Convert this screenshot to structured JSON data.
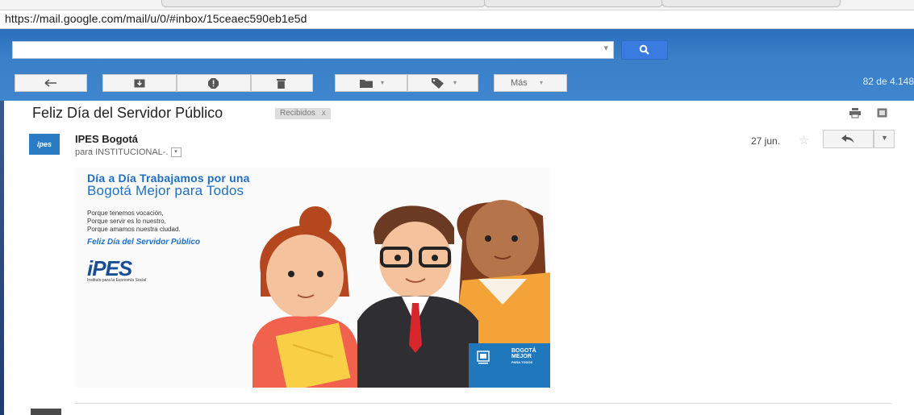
{
  "browser": {
    "url": "https://mail.google.com/mail/u/0/#inbox/15ceaec590eb1e5d"
  },
  "search": {
    "placeholder": ""
  },
  "toolbar": {
    "more_label": "Más",
    "counter": "82 de 4.148",
    "icons": [
      "back-arrow-icon",
      "archive-icon",
      "report-spam-icon",
      "trash-icon",
      "folder-icon",
      "label-icon"
    ]
  },
  "message": {
    "subject": "Feliz Día del Servidor Público",
    "label_chip": "Recibidos",
    "label_close": "x",
    "avatar_text": "ipes",
    "sender": "IPES Bogotá",
    "recipients": "para INSTITUCIONAL-.",
    "date": "27 jun.",
    "star": "☆"
  },
  "banner": {
    "title_line1": "Día a Día Trabajamos por una",
    "title_line2": "Bogotá Mejor para Todos",
    "lines": [
      "Porque tenemos vocación,",
      "Porque servir es lo nuestro,",
      "Porque amamos nuestra ciudad."
    ],
    "feliz": "Feliz Día del Servidor Público",
    "logo": "iPES",
    "logo_sub": "Instituto para la Economía Social",
    "footer_logo": [
      "BOGOTÁ",
      "MEJOR",
      "PARA TODOS"
    ]
  },
  "colors": {
    "header_blue": "#3a7fc8",
    "search_button": "#3a7be0",
    "brand_blue": "#1e6fc4"
  }
}
